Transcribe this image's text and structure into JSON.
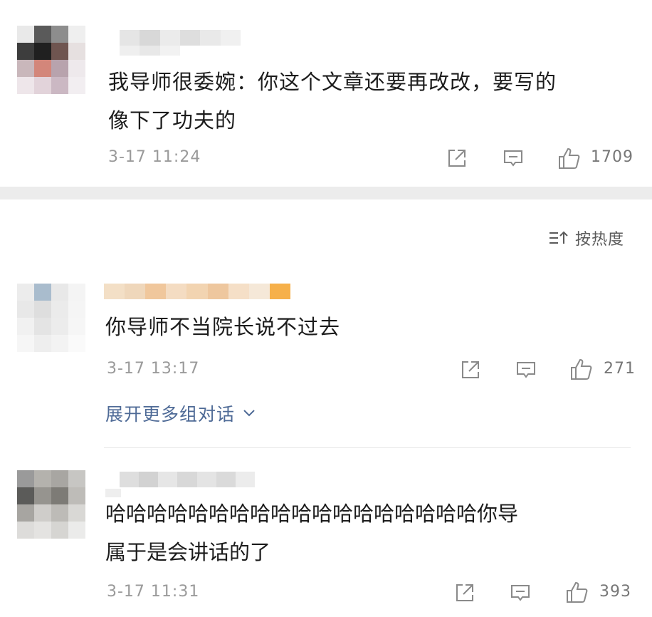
{
  "comments": [
    {
      "text_line1": "我导师很委婉：你这个文章还要再改改，要写的",
      "text_line2": "像下了功夫的",
      "time": "3-17 11:24",
      "likes": "1709"
    },
    {
      "text_line1": "你导师不当院长说不过去",
      "time": "3-17 13:17",
      "likes": "271"
    },
    {
      "text_line1": "哈哈哈哈哈哈哈哈哈哈哈哈哈哈哈哈哈哈你导",
      "text_line2": "属于是会讲话的了",
      "time": "3-17 11:31",
      "likes": "393"
    }
  ],
  "sort": {
    "label": "按热度",
    "icon": "sort-icon"
  },
  "expand": {
    "label": "展开更多组对话",
    "icon": "chevron-down-icon"
  },
  "icons": {
    "share": "share-icon",
    "reply": "comment-icon",
    "like": "thumbs-up-icon"
  },
  "colors": {
    "link": "#4e6a96",
    "meta": "#9a9a9a",
    "band": "#ececec"
  }
}
